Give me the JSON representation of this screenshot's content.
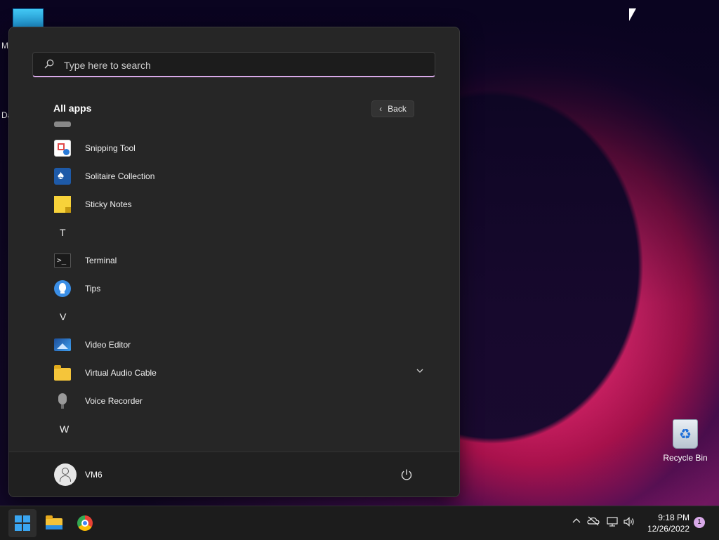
{
  "desktop": {
    "fragment_top": "M",
    "fragment_mid": "Da",
    "recycle_bin_label": "Recycle Bin"
  },
  "start_menu": {
    "search": {
      "placeholder": "Type here to search",
      "value": ""
    },
    "all_apps_title": "All apps",
    "back_label": "Back",
    "apps": [
      {
        "type": "app",
        "label": "",
        "icon": "partial-app-icon"
      },
      {
        "type": "app",
        "label": "Snipping Tool",
        "icon": "snipping-tool-icon"
      },
      {
        "type": "app",
        "label": "Solitaire Collection",
        "icon": "solitaire-icon"
      },
      {
        "type": "app",
        "label": "Sticky Notes",
        "icon": "sticky-notes-icon"
      },
      {
        "type": "letter",
        "label": "T"
      },
      {
        "type": "app",
        "label": "Terminal",
        "icon": "terminal-icon"
      },
      {
        "type": "app",
        "label": "Tips",
        "icon": "tips-icon"
      },
      {
        "type": "letter",
        "label": "V"
      },
      {
        "type": "app",
        "label": "Video Editor",
        "icon": "video-editor-icon"
      },
      {
        "type": "folder",
        "label": "Virtual Audio Cable",
        "icon": "folder-icon",
        "expandable": true
      },
      {
        "type": "app",
        "label": "Voice Recorder",
        "icon": "voice-recorder-icon"
      },
      {
        "type": "letter",
        "label": "W"
      },
      {
        "type": "app",
        "label": "",
        "icon": "partial-app-icon"
      }
    ],
    "user_name": "VM6"
  },
  "taskbar": {
    "pinned": [
      "start-icon",
      "file-explorer-icon",
      "chrome-icon"
    ],
    "clock_time": "9:18 PM",
    "clock_date": "12/26/2022",
    "notification_count": "1"
  },
  "colors": {
    "menu_bg": "#262626",
    "accent": "#d8a9e8",
    "taskbar_bg": "#1c1c1c"
  }
}
